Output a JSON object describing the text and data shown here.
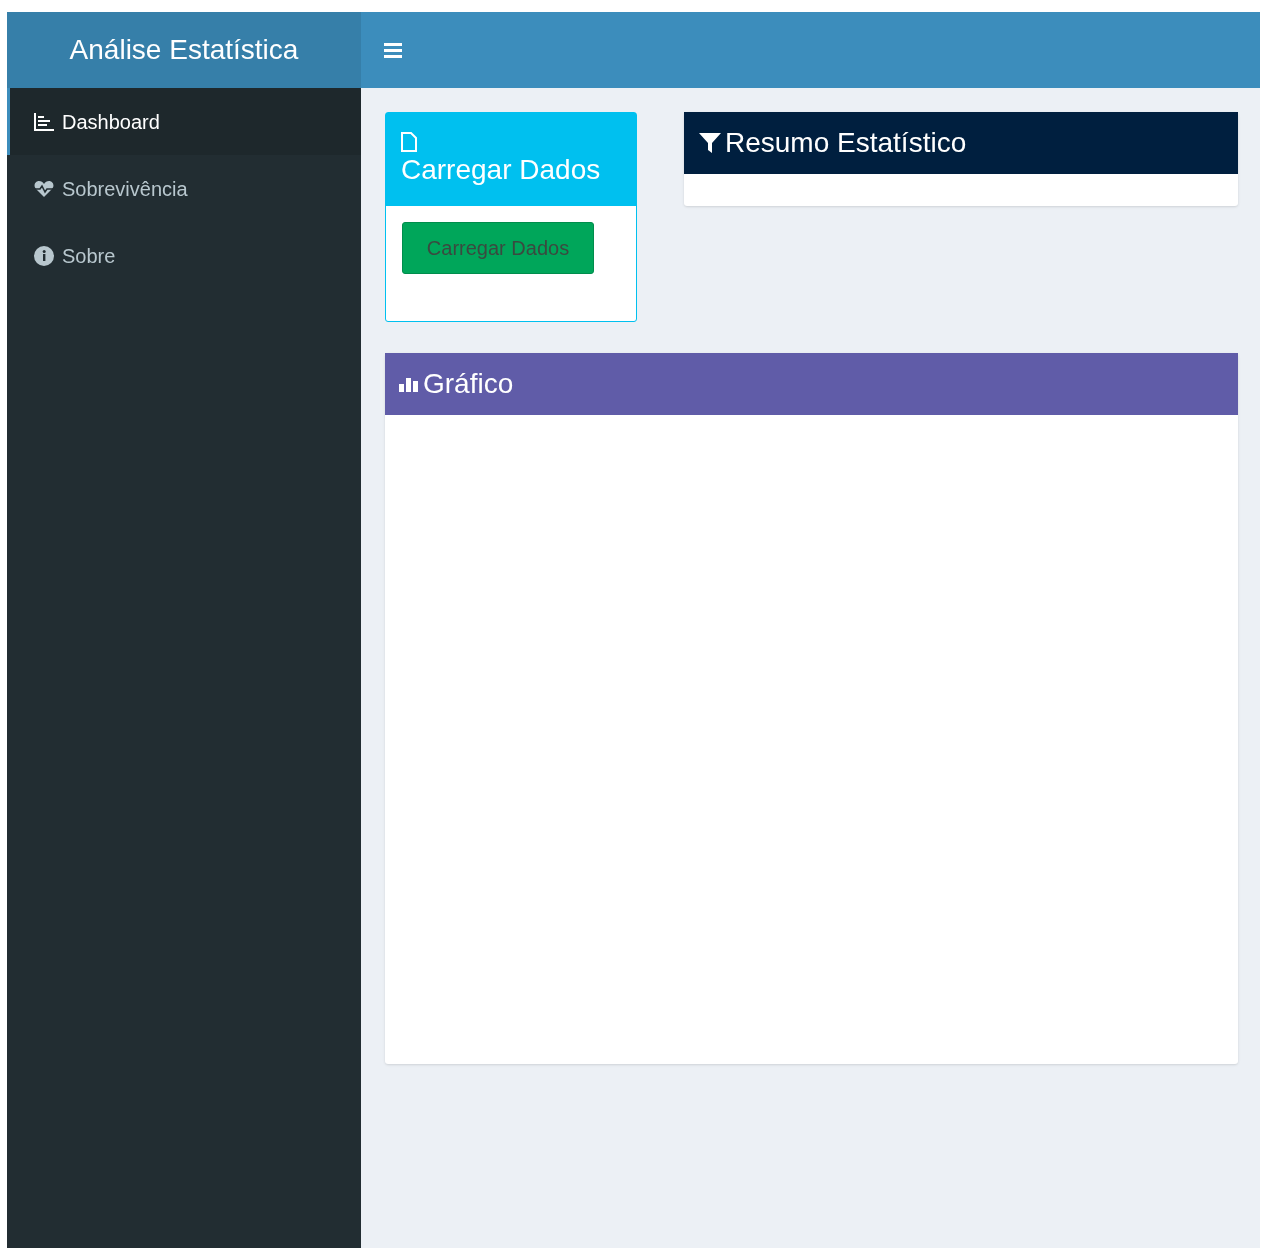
{
  "header": {
    "title": "Análise Estatística"
  },
  "sidebar": {
    "items": [
      {
        "label": "Dashboard",
        "selected": true
      },
      {
        "label": "Sobrevivência",
        "selected": false
      },
      {
        "label": "Sobre",
        "selected": false
      }
    ]
  },
  "upload_box": {
    "title": "Carregar Dados",
    "button": "Carregar Dados"
  },
  "summary_box": {
    "title": "Resumo Estatístico"
  },
  "chart_box": {
    "title": "Gráfico"
  }
}
